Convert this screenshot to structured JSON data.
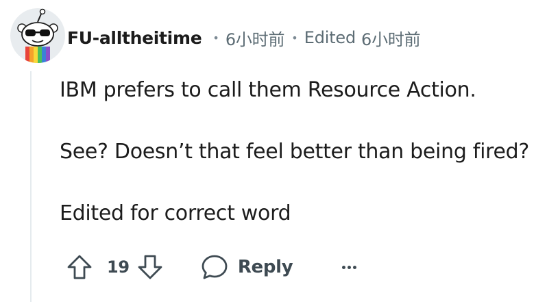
{
  "comment": {
    "author": "FU-alltheitime",
    "time": "6小时前",
    "edited_label": "Edited",
    "edited_time": "6小时前",
    "paragraphs": [
      "IBM prefers to call them Resource Action.",
      "See? Doesn’t that feel better than being fired?",
      "Edited for correct word"
    ],
    "score": "19"
  },
  "actions": {
    "reply_label": "Reply"
  },
  "icons": {
    "avatar": "snoo-avatar-with-sunglasses-rainbow-outfit",
    "upvote": "arrow-up-outline-icon",
    "downvote": "arrow-down-outline-icon",
    "reply": "speech-bubble-icon",
    "more": "horizontal-ellipsis-icon"
  },
  "colors": {
    "text": "#1c1c1c",
    "meta": "#5c6c74",
    "action": "#3e4a52",
    "thread_line": "#e5ebee"
  }
}
